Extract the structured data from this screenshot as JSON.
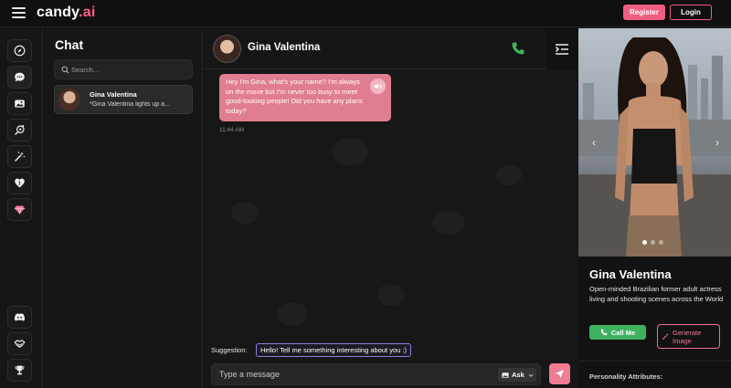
{
  "app": {
    "logo_main": "candy",
    "logo_dot": ".",
    "logo_ai": "ai"
  },
  "header": {
    "register_label": "Register",
    "login_label": "Login"
  },
  "sidebar": {
    "icons": [
      "compass-icon",
      "chat-bubble-icon",
      "gallery-icon",
      "create-character-icon",
      "magic-wand-icon",
      "heart-icon",
      "diamond-icon",
      "discord-icon",
      "affiliate-icon",
      "trophy-icon"
    ]
  },
  "chatlist": {
    "title": "Chat",
    "search_placeholder": "Search...",
    "items": [
      {
        "name": "Gina Valentina",
        "preview": "*Gina Valentina lights up a..."
      }
    ]
  },
  "conversation": {
    "contact_name": "Gina Valentina",
    "messages": [
      {
        "text": "Hey I'm Gina, what's your name? I'm always on the move but I'm never too busy to meet good-looking people! Did you have any plans today?",
        "time": "11:44 AM"
      }
    ],
    "suggestion_label": "Suggestion:",
    "suggestion_text": "Hello! Tell me something interesting about you :)",
    "input_placeholder": "Type a message",
    "ask_label": "Ask"
  },
  "profile": {
    "name": "Gina Valentina",
    "description": "Open-minded Brazilian former adult actress living and shooting scenes across the World",
    "call_label": "Call Me",
    "generate_label": "Generate Image",
    "attributes_label": "Personality Attributes:",
    "carousel_active_index": 0,
    "carousel_count": 3
  },
  "colors": {
    "accent_pink": "#ef5e80",
    "bubble": "#e07d90",
    "call_green": "#3fb261",
    "suggestion_border": "#8c7fe8",
    "background": "#131313"
  }
}
